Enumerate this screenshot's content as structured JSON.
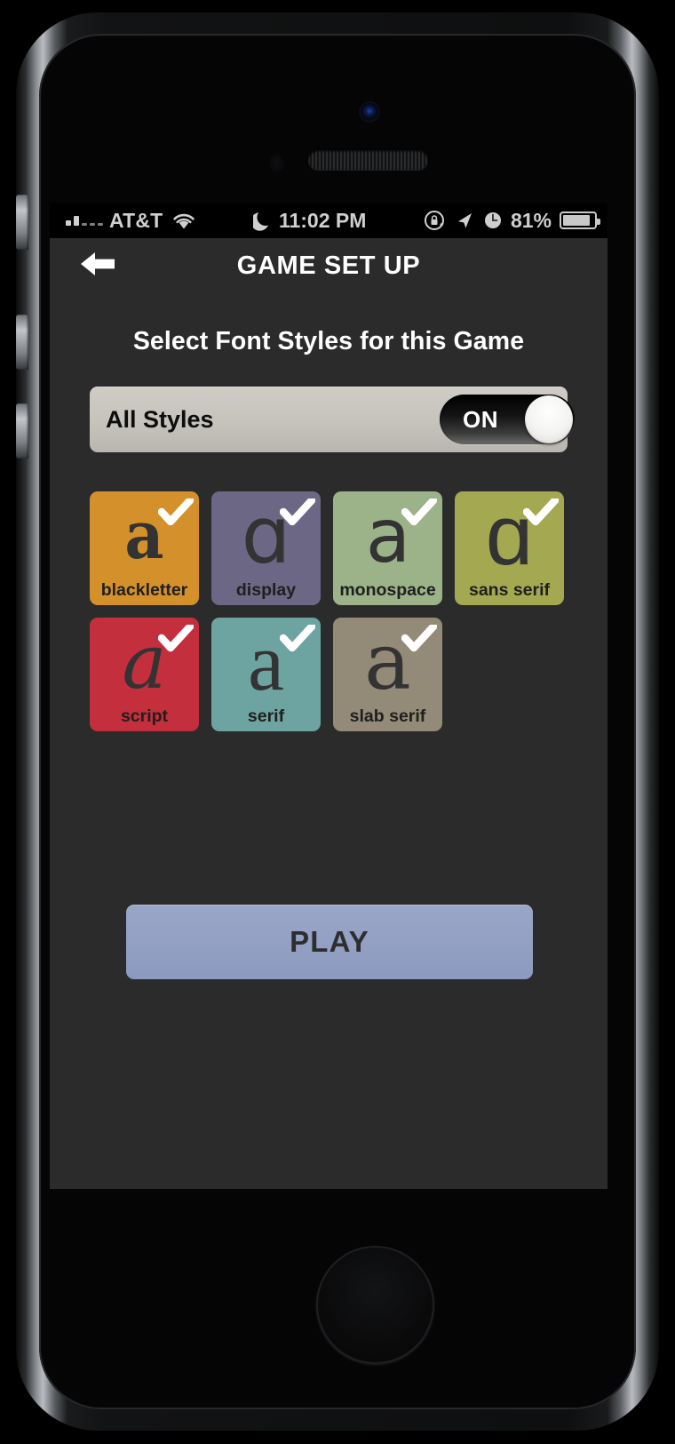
{
  "status_bar": {
    "carrier": "AT&T",
    "signal_icon": "signal-bars-icon",
    "wifi_icon": "wifi-icon",
    "dnd_icon": "moon-do-not-disturb-icon",
    "time": "11:02 PM",
    "rotation_lock_icon": "rotation-lock-icon",
    "location_icon": "location-arrow-icon",
    "alarm_icon": "alarm-clock-icon",
    "battery_percent": "81%",
    "battery_icon": "battery-icon"
  },
  "nav": {
    "back_icon": "back-arrow-icon",
    "title": "GAME SET UP"
  },
  "main": {
    "heading": "Select Font Styles for this Game",
    "all_styles": {
      "label": "All Styles",
      "toggle_state": "ON"
    },
    "styles": [
      {
        "label": "blackletter",
        "glyph": "a",
        "glyph_class": "g-blackletter",
        "color": "#d4912b",
        "checked": true
      },
      {
        "label": "display",
        "glyph": "ɑ",
        "glyph_class": "g-display",
        "color": "#6b6785",
        "checked": true
      },
      {
        "label": "monospace",
        "glyph": "a",
        "glyph_class": "g-monospace",
        "color": "#9cb389",
        "checked": true
      },
      {
        "label": "sans serif",
        "glyph": "ɑ",
        "glyph_class": "g-sansserif",
        "color": "#a3a851",
        "checked": true
      },
      {
        "label": "script",
        "glyph": "a",
        "glyph_class": "g-script",
        "color": "#c32f3c",
        "checked": true
      },
      {
        "label": "serif",
        "glyph": "a",
        "glyph_class": "g-serif",
        "color": "#6da3a1",
        "checked": true
      },
      {
        "label": "slab serif",
        "glyph": "a",
        "glyph_class": "g-slabserif",
        "color": "#938a77",
        "checked": true
      }
    ],
    "play_label": "PLAY"
  },
  "colors": {
    "screen_background": "#2b2b2b",
    "status_bar_background": "#000000",
    "play_button": "#93a0c4",
    "all_styles_row": "#c6c3bc",
    "check_mark": "#ffffff"
  }
}
